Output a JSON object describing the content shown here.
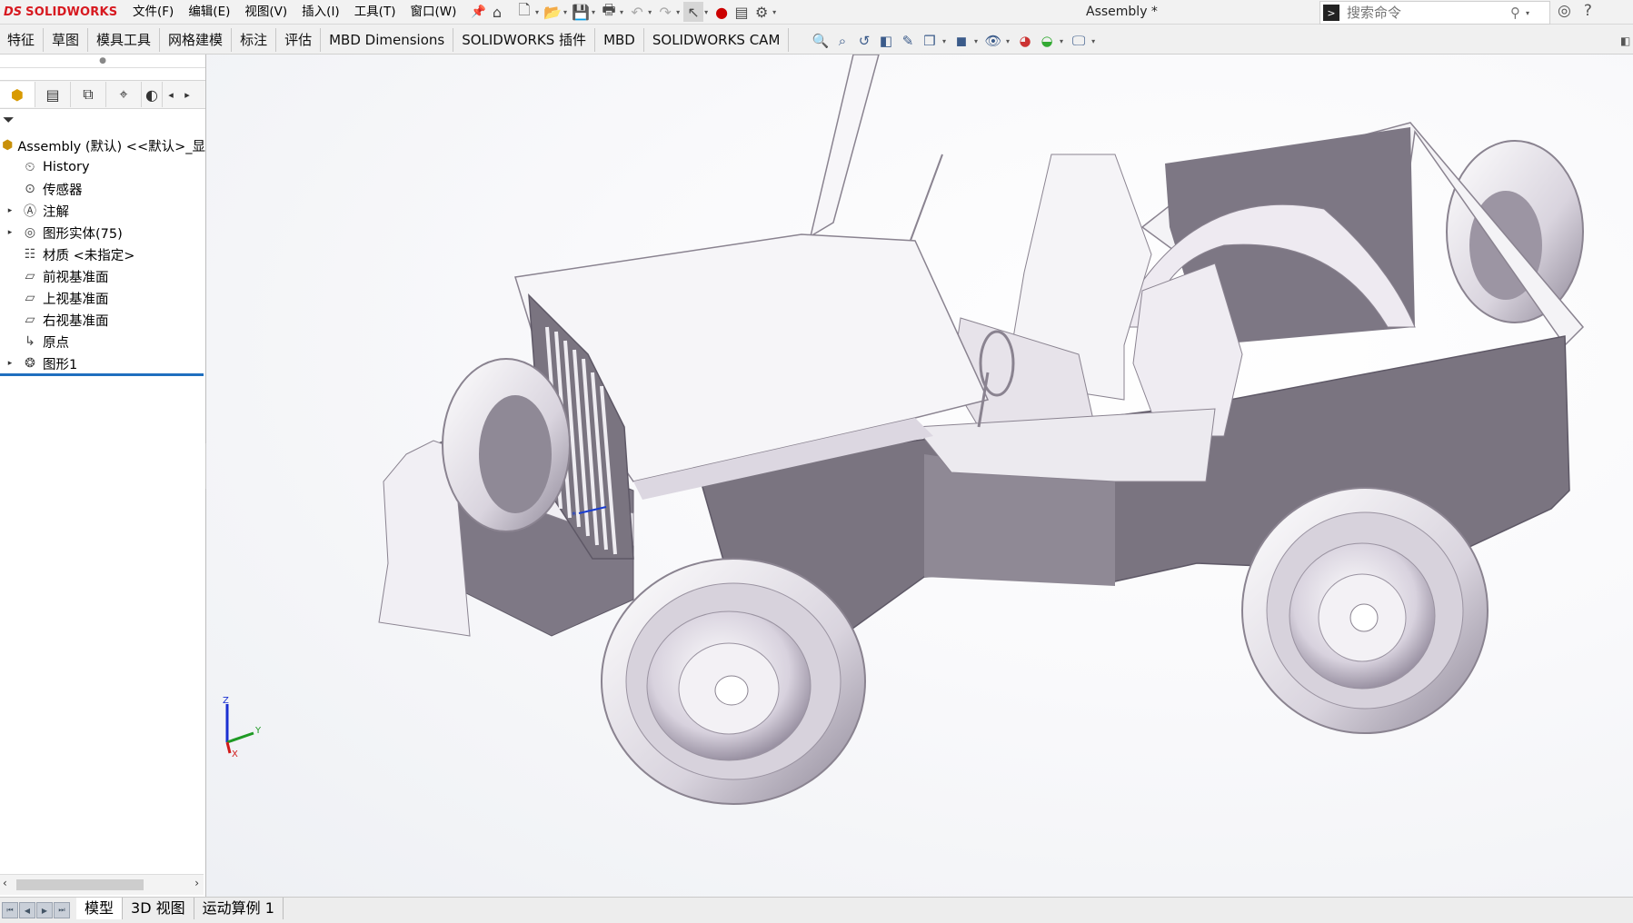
{
  "app": {
    "brand_prefix": "DS",
    "brand_name": "SOLIDWORKS",
    "document_title": "Assembly *"
  },
  "menu": [
    "文件(F)",
    "编辑(E)",
    "视图(V)",
    "插入(I)",
    "工具(T)",
    "窗口(W)"
  ],
  "search": {
    "placeholder": "搜索命令"
  },
  "command_tabs": [
    "特征",
    "草图",
    "模具工具",
    "网格建模",
    "标注",
    "评估",
    "MBD Dimensions",
    "SOLIDWORKS 插件",
    "MBD",
    "SOLIDWORKS CAM"
  ],
  "feature_tree": {
    "root": "Assembly (默认) <<默认>_显",
    "items": [
      {
        "label": "History",
        "icon": "history-icon",
        "expandable": false
      },
      {
        "label": "传感器",
        "icon": "sensor-icon",
        "expandable": false
      },
      {
        "label": "注解",
        "icon": "annotation-icon",
        "expandable": true
      },
      {
        "label": "图形实体(75)",
        "icon": "graphics-body-icon",
        "expandable": true
      },
      {
        "label": "材质 <未指定>",
        "icon": "material-icon",
        "expandable": false
      },
      {
        "label": "前视基准面",
        "icon": "plane-icon",
        "expandable": false
      },
      {
        "label": "上视基准面",
        "icon": "plane-icon",
        "expandable": false
      },
      {
        "label": "右视基准面",
        "icon": "plane-icon",
        "expandable": false
      },
      {
        "label": "原点",
        "icon": "origin-icon",
        "expandable": false
      },
      {
        "label": "图形1",
        "icon": "graphics-icon",
        "expandable": true
      }
    ]
  },
  "bottom_tabs": [
    "模型",
    "3D 视图",
    "运动算例 1"
  ],
  "triad_labels": {
    "x": "X",
    "y": "Y",
    "z": "Z"
  },
  "colors": {
    "brand_red": "#d71920",
    "rollback_bar": "#1f6fbf",
    "model_shade": "#7a7480"
  }
}
